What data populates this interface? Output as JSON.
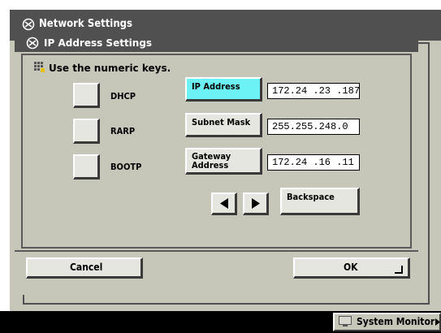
{
  "window": {
    "title": "Network Settings"
  },
  "dialog": {
    "title": "IP Address Settings",
    "instruction": "Use the numeric keys."
  },
  "protocols": [
    {
      "label": "DHCP"
    },
    {
      "label": "RARP"
    },
    {
      "label": "BOOTP"
    }
  ],
  "fields": {
    "ip": {
      "label": "IP Address",
      "value": "172.24 .23 .187",
      "selected": true
    },
    "subnet": {
      "label": "Subnet Mask",
      "value": "255.255.248.0"
    },
    "gateway": {
      "label_line1": "Gateway",
      "label_line2": "Address",
      "value": "172.24 .16 .11"
    }
  },
  "keys": {
    "left_icon": "left-arrow-icon",
    "right_icon": "right-arrow-icon",
    "backspace": "Backspace"
  },
  "footer": {
    "cancel": "Cancel",
    "ok": "OK"
  },
  "statusbar": {
    "system_monitor": "System Monitor"
  },
  "colors": {
    "background": "#c7c7b9",
    "titlebar": "#505050",
    "selected": "#6cf1f4",
    "statusbar": "#000000"
  }
}
